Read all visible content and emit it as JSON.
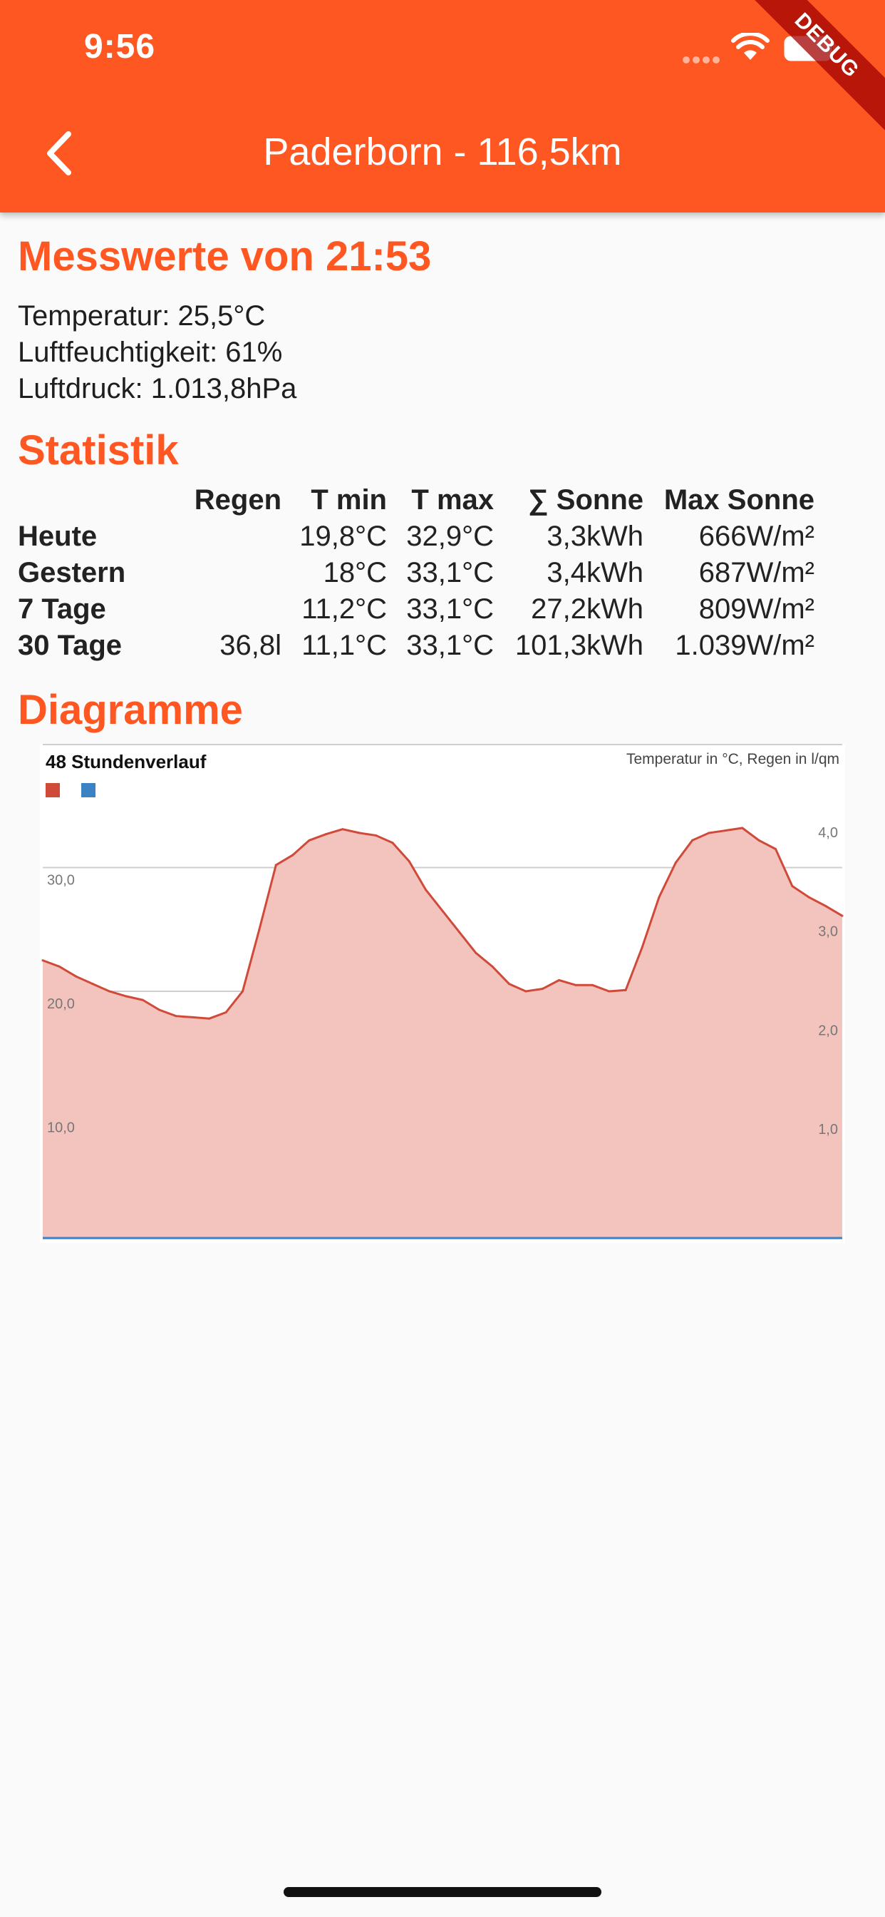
{
  "status_bar": {
    "time": "9:56"
  },
  "debug_ribbon": "DEBUG",
  "app_bar": {
    "title": "Paderborn  - 116,5km"
  },
  "measurements": {
    "heading": "Messwerte von 21:53",
    "temperature": "Temperatur: 25,5°C",
    "humidity": "Luftfeuchtigkeit: 61%",
    "pressure": "Luftdruck: 1.013,8hPa"
  },
  "statistics": {
    "heading": "Statistik",
    "columns": [
      "Regen",
      "T min",
      "T max",
      "∑ Sonne",
      "Max Sonne"
    ],
    "rows": [
      {
        "label": "Heute",
        "cells": [
          "",
          "19,8°C",
          "32,9°C",
          "3,3kWh",
          "666W/m²"
        ]
      },
      {
        "label": "Gestern",
        "cells": [
          "",
          "18°C",
          "33,1°C",
          "3,4kWh",
          "687W/m²"
        ]
      },
      {
        "label": "7 Tage",
        "cells": [
          "",
          "11,2°C",
          "33,1°C",
          "27,2kWh",
          "809W/m²"
        ]
      },
      {
        "label": "30 Tage",
        "cells": [
          "36,8l",
          "11,1°C",
          "33,1°C",
          "101,3kWh",
          "1.039W/m²"
        ]
      }
    ]
  },
  "diagrams": {
    "heading": "Diagramme"
  },
  "chart_data": {
    "type": "area",
    "title": "48 Stundenverlauf",
    "subtitle": "Temperatur in °C, Regen in l/qm",
    "legend": {
      "position": "top-left",
      "colors": [
        "#d04a3a",
        "#3b82c4"
      ]
    },
    "y_left": {
      "ticks": [
        "10,0",
        "20,0",
        "30,0"
      ],
      "range": [
        0,
        40
      ]
    },
    "y_right": {
      "ticks": [
        "1,0",
        "2,0",
        "3,0",
        "4,0"
      ],
      "range": [
        0,
        5
      ]
    },
    "grid": true,
    "series": [
      {
        "color": "#d04a3a",
        "fill": "#f2c4bd",
        "x": [
          0,
          1,
          2,
          3,
          4,
          5,
          6,
          7,
          8,
          9,
          10,
          11,
          12,
          13,
          14,
          15,
          16,
          17,
          18,
          19,
          20,
          21,
          22,
          23,
          24,
          25,
          26,
          27,
          28,
          29,
          30,
          31,
          32,
          33,
          34,
          35,
          36,
          37,
          38,
          39,
          40,
          41,
          42,
          43,
          44,
          45,
          46,
          47,
          48
        ],
        "values": [
          22.5,
          22.0,
          21.2,
          20.6,
          20.0,
          19.6,
          19.3,
          18.5,
          18.0,
          17.9,
          17.8,
          18.3,
          20.0,
          25.0,
          30.2,
          31.0,
          32.2,
          32.7,
          33.1,
          32.8,
          32.6,
          32.0,
          30.5,
          28.2,
          26.5,
          24.8,
          23.1,
          22.0,
          20.6,
          20.0,
          20.2,
          20.9,
          20.5,
          20.5,
          20.0,
          20.1,
          23.6,
          27.6,
          30.4,
          32.2,
          32.8,
          33.0,
          33.2,
          32.2,
          31.5,
          28.5,
          27.6,
          26.9,
          26.1
        ]
      },
      {
        "color": "#3b82c4",
        "values": [
          0,
          0,
          0,
          0,
          0,
          0,
          0,
          0,
          0,
          0,
          0,
          0,
          0,
          0,
          0,
          0,
          0,
          0,
          0,
          0,
          0,
          0,
          0,
          0,
          0,
          0,
          0,
          0,
          0,
          0,
          0,
          0,
          0,
          0,
          0,
          0,
          0,
          0,
          0,
          0,
          0,
          0,
          0,
          0,
          0,
          0,
          0,
          0,
          0
        ]
      }
    ]
  }
}
